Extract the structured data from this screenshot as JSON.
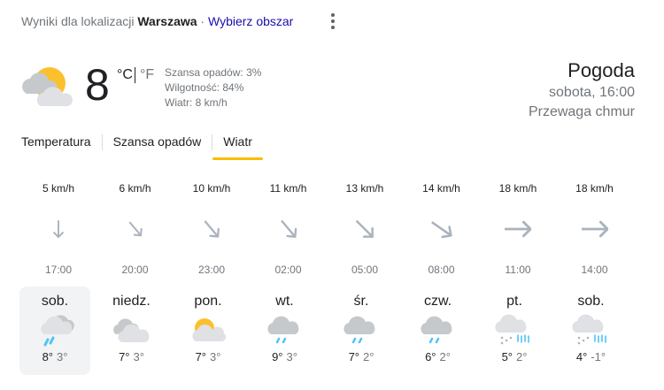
{
  "header": {
    "prefix": "Wyniki dla lokalizacji ",
    "city": "Warszawa",
    "separator": " · ",
    "choose_area": "Wybierz obszar"
  },
  "current": {
    "icon": "partly-cloudy-icon",
    "temperature": "8",
    "unit_c": "°C",
    "unit_f": "°F",
    "precipitation": "Szansa opadów: 3%",
    "humidity": "Wilgotność: 84%",
    "wind": "Wiatr: 8 km/h"
  },
  "title": "Pogoda",
  "datetime": "sobota, 16:00",
  "condition": "Przewaga chmur",
  "tabs": [
    {
      "label": "Temperatura",
      "active": false
    },
    {
      "label": "Szansa opadów",
      "active": false
    },
    {
      "label": "Wiatr",
      "active": true
    }
  ],
  "wind_forecast": [
    {
      "speed": "5 km/h",
      "time": "17:00",
      "direction_deg": 0
    },
    {
      "speed": "6 km/h",
      "time": "20:00",
      "direction_deg": -40
    },
    {
      "speed": "10 km/h",
      "time": "23:00",
      "direction_deg": -40
    },
    {
      "speed": "11 km/h",
      "time": "02:00",
      "direction_deg": -40
    },
    {
      "speed": "13 km/h",
      "time": "05:00",
      "direction_deg": -45
    },
    {
      "speed": "14 km/h",
      "time": "08:00",
      "direction_deg": -55
    },
    {
      "speed": "18 km/h",
      "time": "11:00",
      "direction_deg": -90
    },
    {
      "speed": "18 km/h",
      "time": "14:00",
      "direction_deg": -90
    }
  ],
  "days": [
    {
      "name": "sob.",
      "icon": "showers-cloud-icon",
      "high": "8°",
      "low": "3°",
      "selected": true
    },
    {
      "name": "niedz.",
      "icon": "cloudy-icon",
      "high": "7°",
      "low": "3°",
      "selected": false
    },
    {
      "name": "pon.",
      "icon": "partly-cloudy-icon",
      "high": "7°",
      "low": "3°",
      "selected": false
    },
    {
      "name": "wt.",
      "icon": "rain-icon",
      "high": "9°",
      "low": "3°",
      "selected": false
    },
    {
      "name": "śr.",
      "icon": "rain-icon",
      "high": "7°",
      "low": "2°",
      "selected": false
    },
    {
      "name": "czw.",
      "icon": "rain-icon",
      "high": "6°",
      "low": "2°",
      "selected": false
    },
    {
      "name": "pt.",
      "icon": "rain-snow-icon",
      "high": "5°",
      "low": "2°",
      "selected": false
    },
    {
      "name": "sob.",
      "icon": "rain-snow-icon",
      "high": "4°",
      "low": "-1°",
      "selected": false
    }
  ],
  "colors": {
    "link": "#1a0dab",
    "accent": "#fbbc04",
    "sun": "#fbc02d",
    "cloud": "#dadce0",
    "rain": "#4fc3f7",
    "arrow": "#aab4be"
  }
}
